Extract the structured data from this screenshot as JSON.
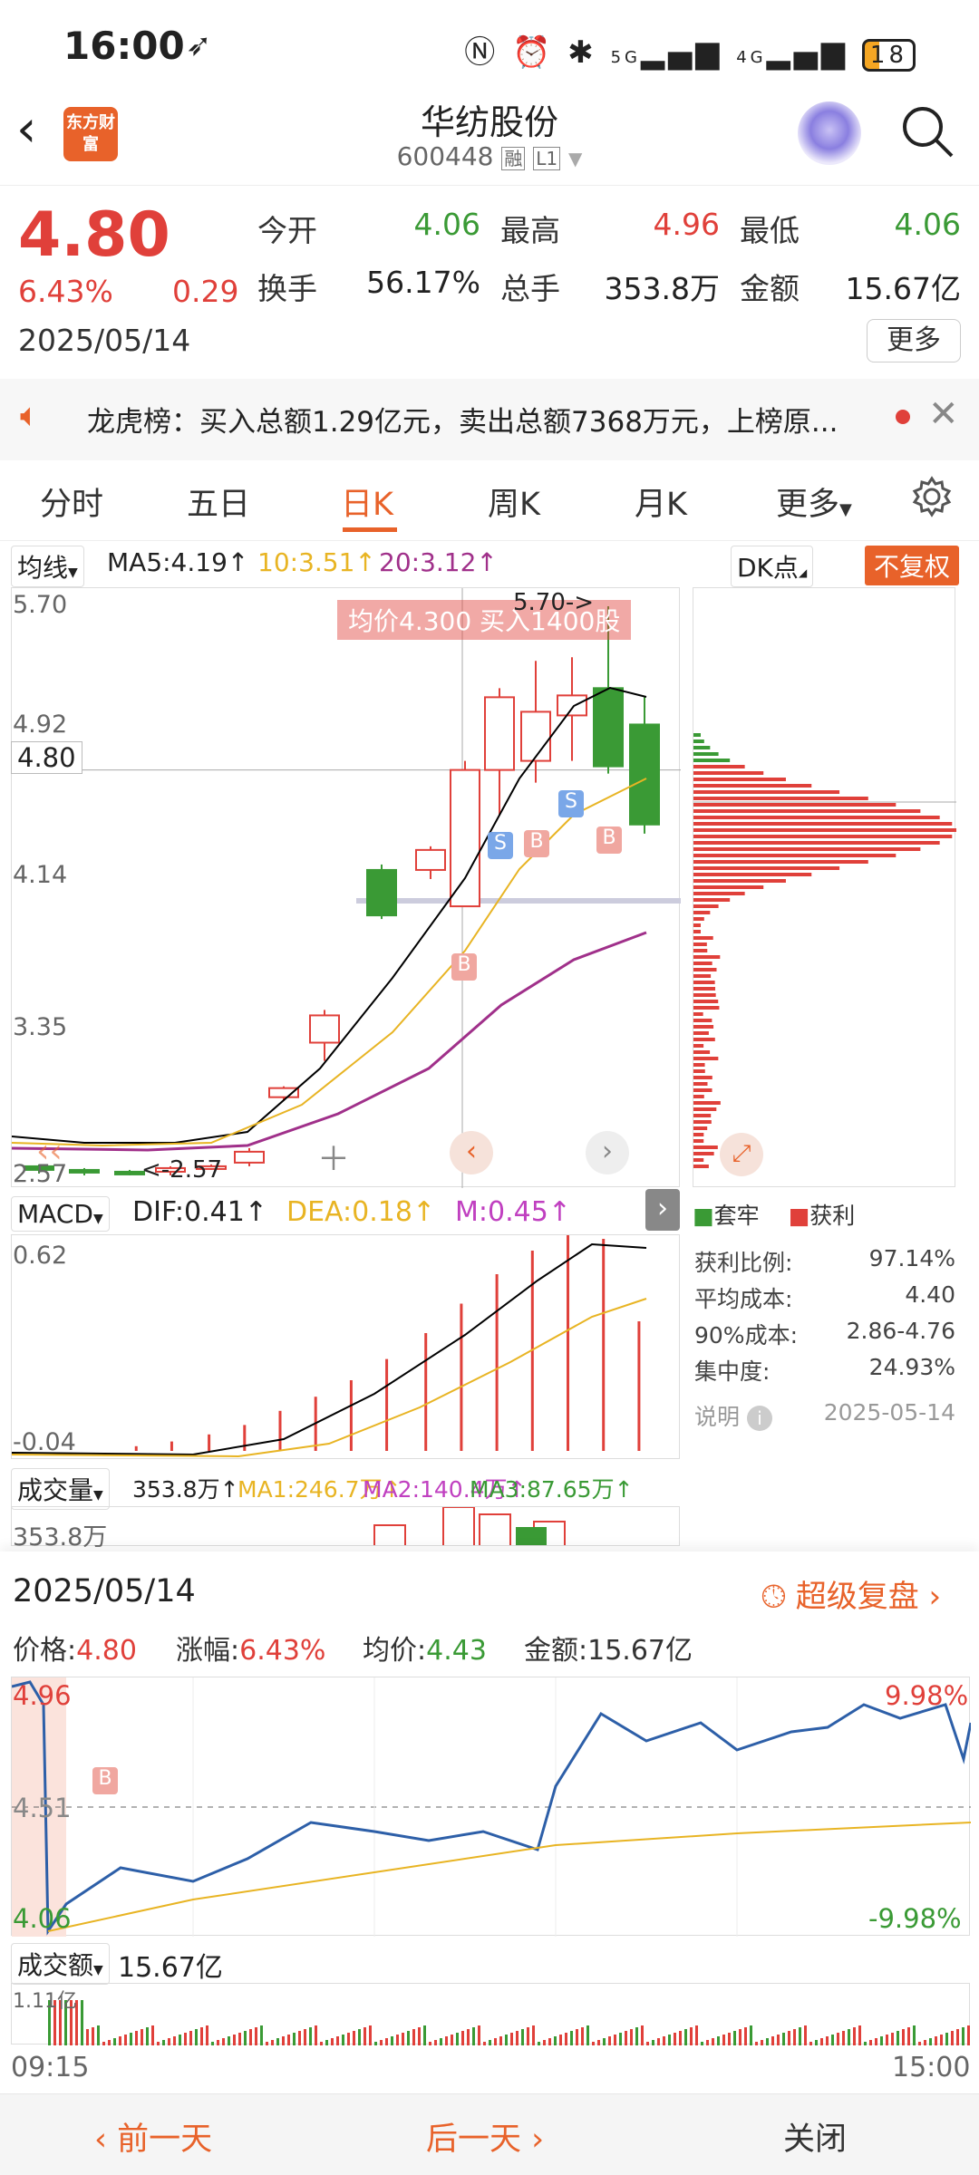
{
  "status_bar": {
    "time": "16:00",
    "network": "5G",
    "network2": "4G",
    "battery": "18"
  },
  "header": {
    "title": "华纺股份",
    "code": "600448",
    "tag1": "融",
    "tag2": "L1",
    "logo_text": "东方财富"
  },
  "quote": {
    "price": "4.80",
    "change_pct": "6.43%",
    "change": "0.29",
    "date": "2025/05/14",
    "open_label": "今开",
    "open": "4.06",
    "high_label": "最高",
    "high": "4.96",
    "low_label": "最低",
    "low": "4.06",
    "turnover_label": "换手",
    "turnover": "56.17%",
    "volume_label": "总手",
    "volume": "353.8万",
    "amount_label": "金额",
    "amount": "15.67亿",
    "more_label": "更多"
  },
  "notice": {
    "text": "龙虎榜：买入总额1.29亿元，卖出总额7368万元，上榜原..."
  },
  "tabs": [
    "分时",
    "五日",
    "日K",
    "周K",
    "月K",
    "更多"
  ],
  "kline": {
    "ma_selector": "均线",
    "ma5": "MA5:4.19↑",
    "ma10": "10:3.51↑",
    "ma20": "20:3.12↑",
    "dk_label": "DK点",
    "fq_label": "不复权",
    "y_labels": [
      "5.70",
      "4.92",
      "4.14",
      "3.35",
      "2.57"
    ],
    "current_price": "4.80",
    "high_marker": "5.70->",
    "low_marker": "<-2.57",
    "tooltip": "均价4.300  买入1400股",
    "signals": [
      "B",
      "S",
      "B",
      "S",
      "B"
    ]
  },
  "chip": {
    "legend_trapped": "套牢",
    "legend_profit": "获利",
    "stats": [
      {
        "label": "获利比例:",
        "value": "97.14%"
      },
      {
        "label": "平均成本:",
        "value": "4.40"
      },
      {
        "label": "90%成本:",
        "value": "2.86-4.76"
      },
      {
        "label": "集中度:",
        "value": "24.93%"
      }
    ],
    "note_label": "说明",
    "note_date": "2025-05-14"
  },
  "macd": {
    "selector": "MACD",
    "dif": "DIF:0.41↑",
    "dea": "DEA:0.18↑",
    "m": "M:0.45↑",
    "y_top": "0.62",
    "y_bottom": "-0.04"
  },
  "volume": {
    "selector": "成交量",
    "value": "353.8万↑",
    "ma1": "MA1:246.7万↑",
    "ma2": "MA2:140.4万↑",
    "ma3": "MA3:87.65万↑",
    "y_top": "353.8万"
  },
  "intraday": {
    "date": "2025/05/14",
    "replay_label": "超级复盘",
    "price_label": "价格:",
    "price": "4.80",
    "change_label": "涨幅:",
    "change": "6.43%",
    "avg_label": "均价:",
    "avg": "4.43",
    "amount_label": "金额:",
    "amount": "15.67亿",
    "y_high": "4.96",
    "y_mid": "4.51",
    "y_low": "4.06",
    "pct_high": "9.98%",
    "pct_low": "-9.98%",
    "signal": "B",
    "amount_selector": "成交额",
    "amount_total": "15.67亿",
    "amount_y": "1.11亿",
    "time_start": "09:15",
    "time_end": "15:00"
  },
  "bottom": {
    "prev": "前一天",
    "next": "后一天",
    "close": "关闭"
  },
  "colors": {
    "up": "#e0403a",
    "down": "#3a9a35",
    "accent": "#e8622a",
    "ma5": "#000000",
    "ma10": "#e8b423",
    "ma20": "#a0308a"
  }
}
